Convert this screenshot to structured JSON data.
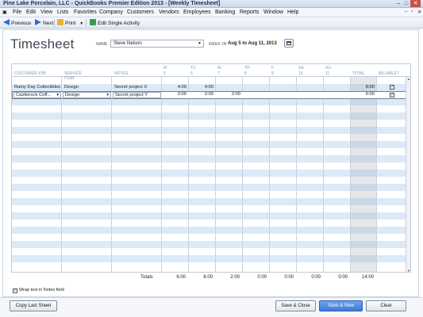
{
  "window": {
    "title": "Pine Lake Porcelain, LLC  - QuickBooks Premier Edition 2013 - [Weekly Timesheet]"
  },
  "menu": [
    "File",
    "Edit",
    "View",
    "Lists",
    "Favorites",
    "Company",
    "Customers",
    "Vendors",
    "Employees",
    "Banking",
    "Reports",
    "Window",
    "Help"
  ],
  "toolbar": {
    "previous": "Previous",
    "next": "Next",
    "print": "Print",
    "edit_single": "Edit Single Activity"
  },
  "form": {
    "heading": "Timesheet",
    "name_label": "NAME",
    "name_value": "Steve Nelson",
    "week_label": "WEEK OF",
    "week_value": "Aug 5 to Aug 11, 2013"
  },
  "columns": {
    "customer_job": "CUSTOMER:JOB",
    "service_item": "SERVICE ITEM",
    "notes": "NOTES",
    "days": [
      {
        "d": "M",
        "n": "5"
      },
      {
        "d": "TU",
        "n": "6"
      },
      {
        "d": "W",
        "n": "7"
      },
      {
        "d": "TH",
        "n": "8"
      },
      {
        "d": "F",
        "n": "9"
      },
      {
        "d": "SA",
        "n": "10"
      },
      {
        "d": "SU",
        "n": "11"
      }
    ],
    "total": "TOTAL",
    "billable": "BILLABLE?"
  },
  "rows": [
    {
      "customer": "Rainy Day Collectibles",
      "service": "Design",
      "notes": "Secret project X",
      "m": "4:00",
      "tu": "4:00",
      "w": "",
      "total": "8:00",
      "billable": "✓"
    },
    {
      "customer": "Castlerock Coff...",
      "service": "Design",
      "notes": "Secret project Y",
      "m": "2:00",
      "tu": "2:00",
      "w": "2:00",
      "total": "6:00",
      "billable": "✓"
    }
  ],
  "totals": {
    "label": "Totals",
    "values": [
      "6:00",
      "6:00",
      "2:00",
      "0:00",
      "0:00",
      "0:00",
      "0:00"
    ],
    "grand": "14:00"
  },
  "wrap_label": "Wrap text in Notes field",
  "buttons": {
    "copy_last": "Copy Last Sheet",
    "save_close": "Save & Close",
    "save_new": "Save & New",
    "clear": "Clear"
  }
}
